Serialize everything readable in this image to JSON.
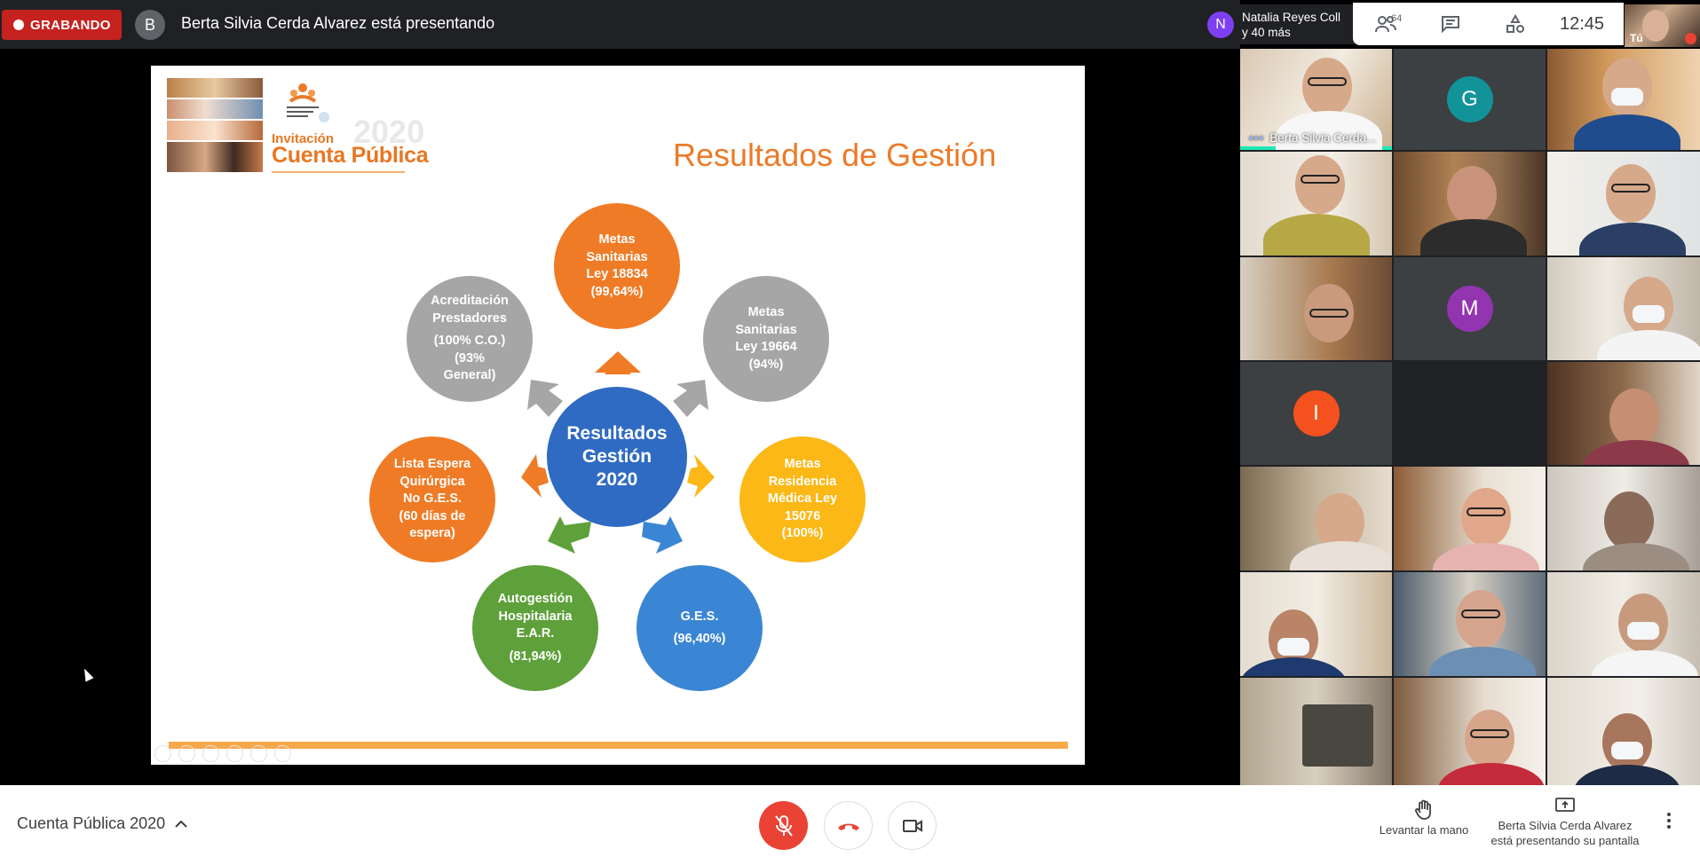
{
  "topbar": {
    "recording_label": "GRABANDO",
    "presenter_initial": "B",
    "presenter_text": "Berta Silvia Cerda Alvarez está presentando",
    "peer_initial": "N",
    "peer_line1": "Natalia Reyes Coll",
    "peer_line2": "y 40 más",
    "people_count": "64",
    "clock": "12:45",
    "self_label": "Tú"
  },
  "slide": {
    "year": "2020",
    "invitation": "Invitación",
    "cuenta_publica": "Cuenta Pública",
    "title": "Resultados de Gestión",
    "center": [
      "Resultados",
      "Gestión",
      "2020"
    ],
    "nodes": {
      "top": {
        "lines": [
          "Metas",
          "Sanitarias",
          "Ley 18834",
          "(99,64%)"
        ],
        "color": "#f07b26"
      },
      "upper_right": {
        "lines": [
          "Metas",
          "Sanitarias",
          "Ley 19664",
          "(94%)"
        ],
        "color": "#a6a6a6"
      },
      "right": {
        "lines": [
          "Metas",
          "Residencia",
          "Médica Ley",
          "15076",
          "(100%)"
        ],
        "color": "#fbb816"
      },
      "lower_right": {
        "lines": [
          "G.E.S."
        ],
        "value": "(96,40%)",
        "color": "#3b86d4"
      },
      "lower_left": {
        "lines": [
          "Autogestión",
          "Hospitalaria",
          "E.A.R."
        ],
        "value": "(81,94%)",
        "color": "#5ea03a"
      },
      "left": {
        "lines": [
          "Lista Espera",
          "Quirúrgica",
          "No G.E.S.",
          "(60 días de",
          "espera)"
        ],
        "color": "#f07b26"
      },
      "upper_left": {
        "lines": [
          "Acreditación",
          "Prestadores"
        ],
        "extra": [
          "(100% C.O.)",
          "(93%",
          "General)"
        ],
        "color": "#a6a6a6"
      }
    },
    "center_color": "#2f6bc2"
  },
  "grid": {
    "speaker_name": "Berta Silvia Cerda...",
    "letters": [
      {
        "letter": "G",
        "color": "#12939a"
      },
      {
        "letter": "M",
        "color": "#9334b0"
      },
      {
        "letter": "I",
        "color": "#f4511e"
      }
    ]
  },
  "bottombar": {
    "meeting_name": "Cuenta Pública 2020",
    "raise_hand": "Levantar la mano",
    "presenting_line1": "Berta Silvia Cerda Alvarez",
    "presenting_line2": "está presentando su pantalla"
  }
}
